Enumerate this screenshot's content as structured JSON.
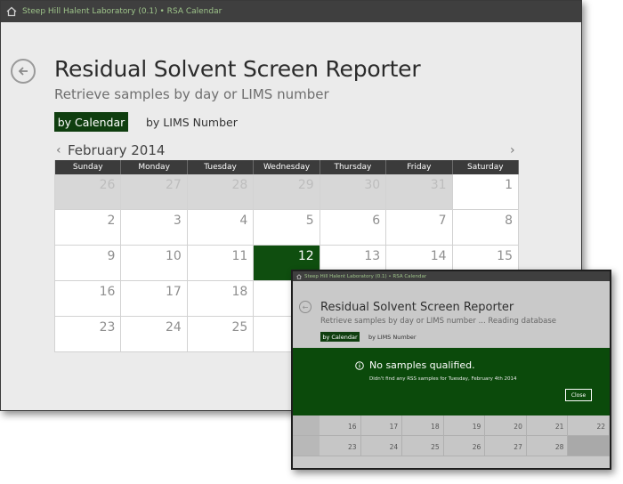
{
  "window": {
    "title": "Steep Hill Halent Laboratory (0.1) • RSA Calendar",
    "header": "Residual Solvent Screen Reporter",
    "subtitle": "Retrieve samples by day or LIMS number",
    "tabs": [
      "by Calendar",
      "by LIMS Number"
    ],
    "month": "February 2014",
    "weekdays": [
      "Sunday",
      "Monday",
      "Tuesday",
      "Wednesday",
      "Thursday",
      "Friday",
      "Saturday"
    ],
    "days": [
      {
        "n": "26",
        "out": true
      },
      {
        "n": "27",
        "out": true
      },
      {
        "n": "28",
        "out": true
      },
      {
        "n": "29",
        "out": true
      },
      {
        "n": "30",
        "out": true
      },
      {
        "n": "31",
        "out": true
      },
      {
        "n": "1"
      },
      {
        "n": "2"
      },
      {
        "n": "3"
      },
      {
        "n": "4"
      },
      {
        "n": "5"
      },
      {
        "n": "6"
      },
      {
        "n": "7"
      },
      {
        "n": "8"
      },
      {
        "n": "9"
      },
      {
        "n": "10"
      },
      {
        "n": "11"
      },
      {
        "n": "12",
        "selected": true
      },
      {
        "n": "13"
      },
      {
        "n": "14"
      },
      {
        "n": "15"
      },
      {
        "n": "16"
      },
      {
        "n": "17"
      },
      {
        "n": "18"
      },
      {
        "n": ""
      },
      {
        "n": ""
      },
      {
        "n": ""
      },
      {
        "n": ""
      },
      {
        "n": "23"
      },
      {
        "n": "24"
      },
      {
        "n": "25"
      },
      {
        "n": ""
      },
      {
        "n": ""
      },
      {
        "n": ""
      },
      {
        "n": ""
      }
    ],
    "accent": "#0f4e0f"
  },
  "overlay": {
    "title": "Steep Hill Halent Laboratory (0.1) • RSA Calendar",
    "header": "Residual Solvent Screen Reporter",
    "subtitle": "Retrieve samples by day or LIMS number ... Reading database",
    "tabs": [
      "by Calendar",
      "by LIMS Number"
    ],
    "message": "No samples qualified.",
    "detail": "Didn't find any RSS samples for Tuesday, February 4th 2014",
    "close_label": "Close",
    "rows": [
      [
        "16",
        "17",
        "18",
        "19",
        "20",
        "21",
        "22"
      ],
      [
        "23",
        "24",
        "25",
        "26",
        "27",
        "28",
        ""
      ]
    ],
    "banner_color": "#0b4a0b"
  }
}
